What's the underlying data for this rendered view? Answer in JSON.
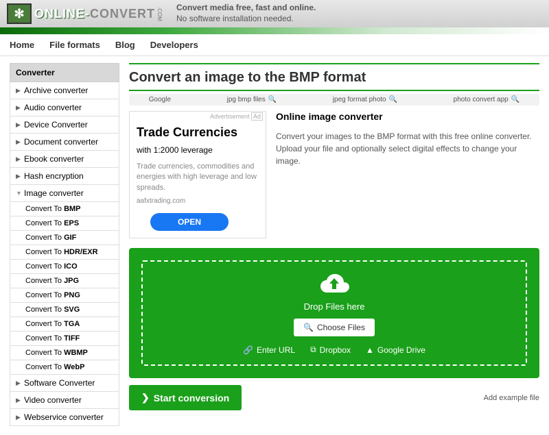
{
  "header": {
    "logo_online": "ONLINE-",
    "logo_convert": "CONVERT",
    "logo_com": ".COM",
    "tagline1": "Convert media free, fast and online.",
    "tagline2": "No software installation needed."
  },
  "nav": {
    "home": "Home",
    "formats": "File formats",
    "blog": "Blog",
    "devs": "Developers"
  },
  "sidebar": {
    "header": "Converter",
    "items": [
      "Archive converter",
      "Audio converter",
      "Device Converter",
      "Document converter",
      "Ebook converter",
      "Hash encryption"
    ],
    "expanded": "Image converter",
    "subs": [
      {
        "pre": "Convert To ",
        "fmt": "BMP"
      },
      {
        "pre": "Convert To ",
        "fmt": "EPS"
      },
      {
        "pre": "Convert To ",
        "fmt": "GIF"
      },
      {
        "pre": "Convert To ",
        "fmt": "HDR/EXR"
      },
      {
        "pre": "Convert To ",
        "fmt": "ICO"
      },
      {
        "pre": "Convert To ",
        "fmt": "JPG"
      },
      {
        "pre": "Convert To ",
        "fmt": "PNG"
      },
      {
        "pre": "Convert To ",
        "fmt": "SVG"
      },
      {
        "pre": "Convert To ",
        "fmt": "TGA"
      },
      {
        "pre": "Convert To ",
        "fmt": "TIFF"
      },
      {
        "pre": "Convert To ",
        "fmt": "WBMP"
      },
      {
        "pre": "Convert To ",
        "fmt": "WebP"
      }
    ],
    "after": [
      "Software Converter",
      "Video converter",
      "Webservice converter"
    ]
  },
  "main": {
    "title": "Convert an image to the BMP format",
    "search": {
      "t1": "Google",
      "t2": "jpg bmp files",
      "t3": "jpeg format photo",
      "t4": "photo convert app"
    },
    "ad": {
      "label": "Advertisement",
      "badge": "Ad",
      "title": "Trade Currencies",
      "sub": "with 1:2000 leverage",
      "desc": "Trade currencies, commodities and energies with high leverage and low spreads.",
      "domain": "aafxtrading.com",
      "cta": "OPEN"
    },
    "desc_title": "Online image converter",
    "desc_text": "Convert your images to the BMP format with this free online converter. Upload your file and optionally select digital effects to change your image.",
    "drop": {
      "label": "Drop Files here",
      "choose": "Choose Files",
      "url": "Enter URL",
      "dropbox": "Dropbox",
      "gdrive": "Google Drive"
    },
    "start": "Start conversion",
    "example": "Add example file"
  }
}
